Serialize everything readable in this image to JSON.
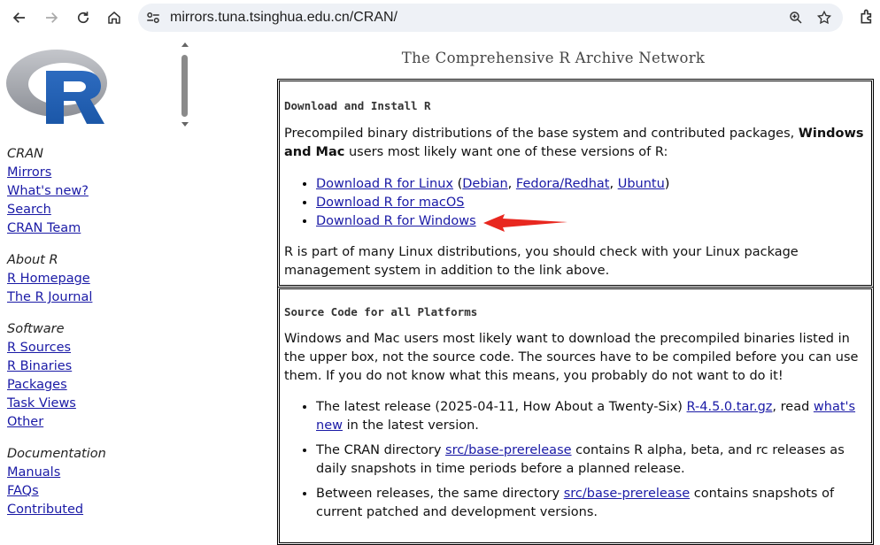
{
  "browser": {
    "url": "mirrors.tuna.tsinghua.edu.cn/CRAN/"
  },
  "sidebar": {
    "sections": [
      {
        "heading": "CRAN",
        "links": [
          "Mirrors",
          "What's new?",
          "Search",
          "CRAN Team"
        ]
      },
      {
        "heading": "About R",
        "links": [
          "R Homepage",
          "The R Journal"
        ]
      },
      {
        "heading": "Software",
        "links": [
          "R Sources",
          "R Binaries",
          "Packages",
          "Task Views",
          "Other"
        ]
      },
      {
        "heading": "Documentation",
        "links": [
          "Manuals",
          "FAQs",
          "Contributed"
        ]
      }
    ]
  },
  "main": {
    "title": "The Comprehensive R Archive Network",
    "download": {
      "heading": "Download and Install R",
      "intro_before": "Precompiled binary distributions of the base system and contributed packages, ",
      "intro_bold": "Windows and Mac",
      "intro_after": " users most likely want one of these versions of R:",
      "linux_link": "Download R for Linux",
      "debian": "Debian",
      "fedora": "Fedora/Redhat",
      "ubuntu": "Ubuntu",
      "macos_link": "Download R for macOS",
      "windows_link": "Download R for Windows",
      "outro": "R is part of many Linux distributions, you should check with your Linux package management system in addition to the link above."
    },
    "source": {
      "heading": "Source Code for all Platforms",
      "intro": "Windows and Mac users most likely want to download the precompiled binaries listed in the upper box, not the source code. The sources have to be compiled before you can use them. If you do not know what this means, you probably do not want to do it!",
      "item1_a": "The latest release (2025-04-11, How About a Twenty-Six) ",
      "item1_link": "R-4.5.0.tar.gz",
      "item1_b": ", read ",
      "item1_link2": "what's new",
      "item1_c": " in the latest version.",
      "item2_a": "The CRAN directory ",
      "item2_link": "src/base-prerelease",
      "item2_b": " contains R alpha, beta, and rc releases as daily snapshots in time periods before a planned release.",
      "item3_a": "Between releases, the same directory ",
      "item3_link": "src/base-prerelease",
      "item3_b": " contains snapshots of current patched and development versions."
    }
  },
  "annotation": {
    "arrow_color": "#e8271f"
  }
}
